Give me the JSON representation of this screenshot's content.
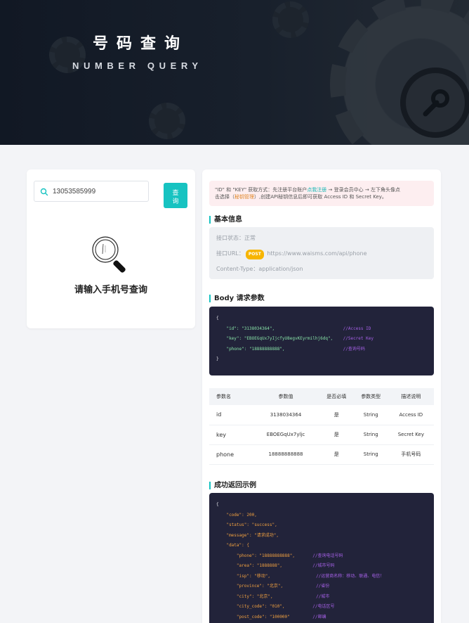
{
  "banner": {
    "title": "号码查询",
    "subtitle": "NUMBER QUERY"
  },
  "search": {
    "value": "13053585999",
    "button_label": "查询"
  },
  "empty_state": {
    "text": "请输入手机号查询"
  },
  "notice": {
    "line1_a": "\"ID\" 和 \"KEY\" 获取方式：先注册平台账户",
    "line1_link": "点我注册",
    "line1_b": " → 登录会员中心 → 左下角头像点",
    "line2_a": "击选择（",
    "line2_em": "秘钥管理",
    "line2_b": "）,创建API秘钥信息后即可获取 Access ID 和 Secret Key。"
  },
  "basic_info": {
    "title": "基本信息",
    "status_label": "接口状态：",
    "status_value": "正常",
    "url_label": "接口URL：",
    "method": "POST",
    "url": "https://www.waisms.com/api/phone",
    "content_type_label": "Content-Type：",
    "content_type": "application/json"
  },
  "body_params": {
    "title": "Body 请求参数",
    "open": "{",
    "close": "}",
    "lines": [
      {
        "key": "\"id\": \"3138034364\",",
        "comment": "//Access ID"
      },
      {
        "key": "\"key\": \"EBOEGqUx7yIjcfyU8egvKEyrmilhj6dq\",",
        "comment": "//Secret Key"
      },
      {
        "key": "\"phone\": \"18888888888\",",
        "comment": "//查询号码"
      }
    ]
  },
  "params_table": {
    "headers": [
      "参数名",
      "参数值",
      "是否必填",
      "参数类型",
      "描述说明"
    ],
    "rows": [
      [
        "id",
        "3138034364",
        "是",
        "String",
        "Access ID"
      ],
      [
        "key",
        "EBOEGqUx7yljc",
        "是",
        "String",
        "Secret Key"
      ],
      [
        "phone",
        "18888888888",
        "是",
        "String",
        "手机号码"
      ]
    ]
  },
  "success_example": {
    "title": "成功返回示例",
    "open": "{",
    "top_lines": [
      "\"code\": 200,",
      "\"status\": \"success\",",
      "\"message\": \"请求成功\",",
      "\"data\": {"
    ],
    "data_lines": [
      {
        "key": "\"phone\": \"18888888888\",",
        "comment": "//查询电话号码"
      },
      {
        "key": "\"area\": \"1888888\",",
        "comment": "//城市号码"
      },
      {
        "key": "\"isp\": \"移动\",",
        "comment": "//运营商名称：移动、联通、电信！"
      },
      {
        "key": "\"province\": \"北京\",",
        "comment": "//省份"
      },
      {
        "key": "\"city\": \"北京\",",
        "comment": "//城市"
      },
      {
        "key": "\"city_code\": \"010\",",
        "comment": "//电话区号"
      },
      {
        "key": "\"post_code\": \"100000\"",
        "comment": "//邮编"
      }
    ]
  },
  "colors": {
    "accent": "#17c3c1",
    "banner_bg": "#111824",
    "code_bg": "#22233a",
    "post_badge": "#f7b500"
  }
}
